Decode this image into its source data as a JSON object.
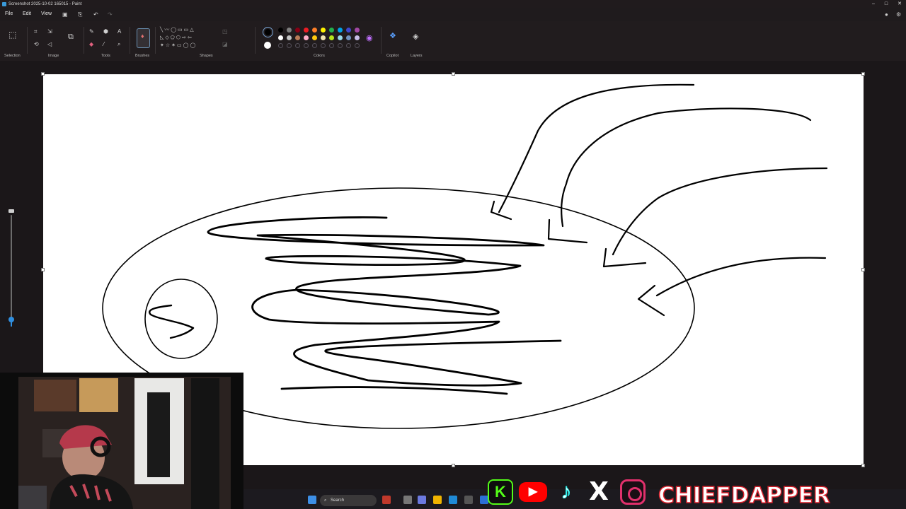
{
  "window": {
    "title": "Screenshot 2025-10-02 165015 - Paint",
    "controls": [
      "–",
      "□",
      "✕"
    ]
  },
  "menu": {
    "file": "File",
    "edit": "Edit",
    "view": "View"
  },
  "ribbon": {
    "groups": {
      "selection": "Selection",
      "image": "Image",
      "tools": "Tools",
      "brushes": "Brushes",
      "shapes": "Shapes",
      "colors": "Colors",
      "copilot": "Copilot",
      "layers": "Layers"
    },
    "palette_row1": [
      "#000000",
      "#7f7f7f",
      "#880015",
      "#ed1c24",
      "#ff7f27",
      "#fff200",
      "#22b14c",
      "#00a2e8",
      "#3f48cc",
      "#a349a4"
    ],
    "palette_row2": [
      "#ffffff",
      "#c3c3c3",
      "#b97a57",
      "#ffaec9",
      "#ffc90e",
      "#efe4b0",
      "#b5e61d",
      "#99d9ea",
      "#7092be",
      "#c8bfe7"
    ],
    "primary_color": "#000000",
    "secondary_color": "#ffffff"
  },
  "zoom": {
    "level_fraction": 0.05
  },
  "taskbar": {
    "search_label": "Search",
    "start_icon": "windows-icon"
  },
  "overlay": {
    "brand_text": "CHIEFDAPPER",
    "social_icons": [
      "kick-icon",
      "youtube-icon",
      "tiktok-icon",
      "x-icon",
      "instagram-icon"
    ],
    "kick_glyph": "K",
    "x_glyph": "X"
  },
  "colors": {
    "accent": "#2f8fe0",
    "brand_stroke": "#d81f2a",
    "kick_green": "#53fc18",
    "youtube_red": "#ff0000"
  }
}
